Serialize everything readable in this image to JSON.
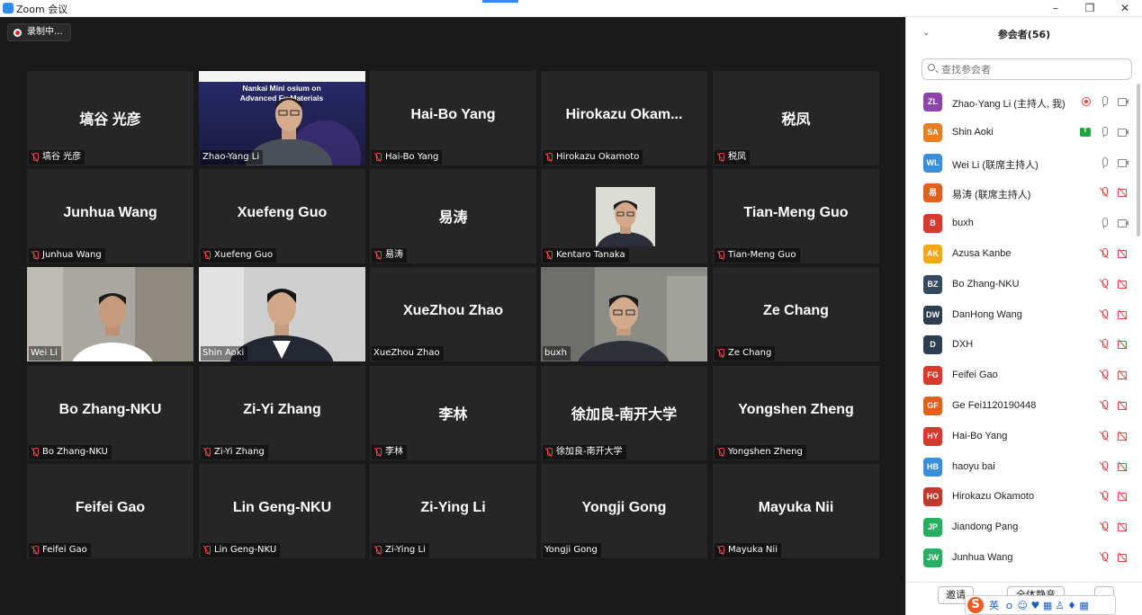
{
  "window": {
    "title": "Zoom 会议",
    "controls": [
      "–",
      "❐",
      "✕"
    ]
  },
  "recording": {
    "label": "录制中..."
  },
  "tiles": [
    {
      "big": "塙谷 光彦",
      "label": "塙谷 光彦",
      "muted": true,
      "video": false
    },
    {
      "big": "",
      "label": "Zhao-Yang Li",
      "muted": false,
      "video": true,
      "kind": "presenter",
      "banner": "Nankai Mini Symposium on Advanced Functional Materials",
      "banner_visible": "Nankai Mini  osium on Advanced Fu    Materials"
    },
    {
      "big": "Hai-Bo Yang",
      "label": "Hai-Bo Yang",
      "muted": true,
      "video": false
    },
    {
      "big": "Hirokazu  Okam...",
      "label": "Hirokazu Okamoto",
      "muted": true,
      "video": false
    },
    {
      "big": "税凤",
      "label": "税凤",
      "muted": true,
      "video": false
    },
    {
      "big": "Junhua Wang",
      "label": "Junhua Wang",
      "muted": true,
      "video": false
    },
    {
      "big": "Xuefeng Guo",
      "label": "Xuefeng Guo",
      "muted": true,
      "video": false
    },
    {
      "big": "易涛",
      "label": "易涛",
      "muted": true,
      "video": false
    },
    {
      "big": "",
      "label": "Kentaro Tanaka",
      "muted": true,
      "video": false,
      "kind": "photo"
    },
    {
      "big": "Tian-Meng Guo",
      "label": "Tian-Meng Guo",
      "muted": true,
      "video": false
    },
    {
      "big": "",
      "label": "Wei Li",
      "muted": false,
      "video": true,
      "kind": "weili"
    },
    {
      "big": "",
      "label": "Shin Aoki",
      "muted": false,
      "video": true,
      "kind": "shinaoki"
    },
    {
      "big": "XueZhou Zhao",
      "label": "XueZhou Zhao",
      "muted": false,
      "video": false
    },
    {
      "big": "",
      "label": "buxh",
      "muted": false,
      "video": true,
      "kind": "buxh",
      "active": true
    },
    {
      "big": "Ze Chang",
      "label": "Ze Chang",
      "muted": true,
      "video": false
    },
    {
      "big": "Bo Zhang-NKU",
      "label": "Bo Zhang-NKU",
      "muted": true,
      "video": false
    },
    {
      "big": "Zi-Yi Zhang",
      "label": "Zi-Yi Zhang",
      "muted": true,
      "video": false
    },
    {
      "big": "李林",
      "label": "李林",
      "muted": true,
      "video": false
    },
    {
      "big": "徐加良-南开大学",
      "label": "徐加良-南开大学",
      "muted": true,
      "video": false
    },
    {
      "big": "Yongshen Zheng",
      "label": "Yongshen Zheng",
      "muted": true,
      "video": false
    },
    {
      "big": "Feifei Gao",
      "label": "Feifei Gao",
      "muted": true,
      "video": false
    },
    {
      "big": "Lin Geng-NKU",
      "label": "Lin Geng-NKU",
      "muted": true,
      "video": false
    },
    {
      "big": "Zi-Ying Li",
      "label": "Zi-Ying Li",
      "muted": true,
      "video": false
    },
    {
      "big": "Yongji Gong",
      "label": "Yongji Gong",
      "muted": false,
      "video": false
    },
    {
      "big": "Mayuka Nii",
      "label": "Mayuka Nii",
      "muted": true,
      "video": false
    }
  ],
  "panel": {
    "title": "参会者(56)",
    "search_placeholder": "查找参会者",
    "participants": [
      {
        "initials": "ZL",
        "color": "#8e44ad",
        "name": "Zhao-Yang Li (主持人, 我)",
        "icons": [
          "rec",
          "mic",
          "cam"
        ]
      },
      {
        "initials": "SA",
        "color": "#e67e22",
        "name": "Shin Aoki",
        "icons": [
          "share",
          "mic",
          "cam"
        ]
      },
      {
        "initials": "WL",
        "color": "#3b8ed8",
        "name": "Wei Li (联席主持人)",
        "icons": [
          "mic",
          "cam"
        ]
      },
      {
        "initials": "易",
        "color": "#e0601c",
        "name": "易涛 (联席主持人)",
        "icons": [
          "micoff",
          "camoff"
        ]
      },
      {
        "initials": "B",
        "color": "#d63a2f",
        "name": "buxh",
        "icons": [
          "mic",
          "cam"
        ]
      },
      {
        "initials": "AK",
        "color": "#f2a81d",
        "name": "Azusa Kanbe",
        "icons": [
          "micoff",
          "camoff"
        ]
      },
      {
        "initials": "BZ",
        "color": "#34495e",
        "name": "Bo Zhang-NKU",
        "icons": [
          "micoff",
          "camoff"
        ]
      },
      {
        "initials": "DW",
        "color": "#2c3e50",
        "name": "DanHong Wang",
        "icons": [
          "micoff",
          "camoff"
        ]
      },
      {
        "initials": "D",
        "color": "#2c3e50",
        "name": "DXH",
        "icons": [
          "micoff",
          "camoff"
        ]
      },
      {
        "initials": "FG",
        "color": "#d63a2f",
        "name": "Feifei Gao",
        "icons": [
          "micoff",
          "camoff"
        ]
      },
      {
        "initials": "GF",
        "color": "#e0601c",
        "name": "Ge Fei1120190448",
        "icons": [
          "micoff",
          "camoff"
        ]
      },
      {
        "initials": "HY",
        "color": "#d63a2f",
        "name": "Hai-Bo Yang",
        "icons": [
          "micoff",
          "camoff"
        ]
      },
      {
        "initials": "HB",
        "color": "#3b8ed8",
        "name": "haoyu bai",
        "icons": [
          "micoff",
          "camoff"
        ]
      },
      {
        "initials": "HO",
        "color": "#c0392b",
        "name": "Hirokazu Okamoto",
        "icons": [
          "micoff",
          "camoff"
        ]
      },
      {
        "initials": "JP",
        "color": "#27ae60",
        "name": "Jiandong Pang",
        "icons": [
          "micoff",
          "camoff"
        ]
      },
      {
        "initials": "JW",
        "color": "#27ae60",
        "name": "Junhua Wang",
        "icons": [
          "micoff",
          "camoff"
        ]
      }
    ],
    "footer": {
      "invite": "邀请",
      "mute_all": "全体静音",
      "more": "..."
    }
  },
  "ime": {
    "lang": "英",
    "glyphs": "ｏ ☺ ♥ ▦ ♙ ♦ ▦"
  }
}
